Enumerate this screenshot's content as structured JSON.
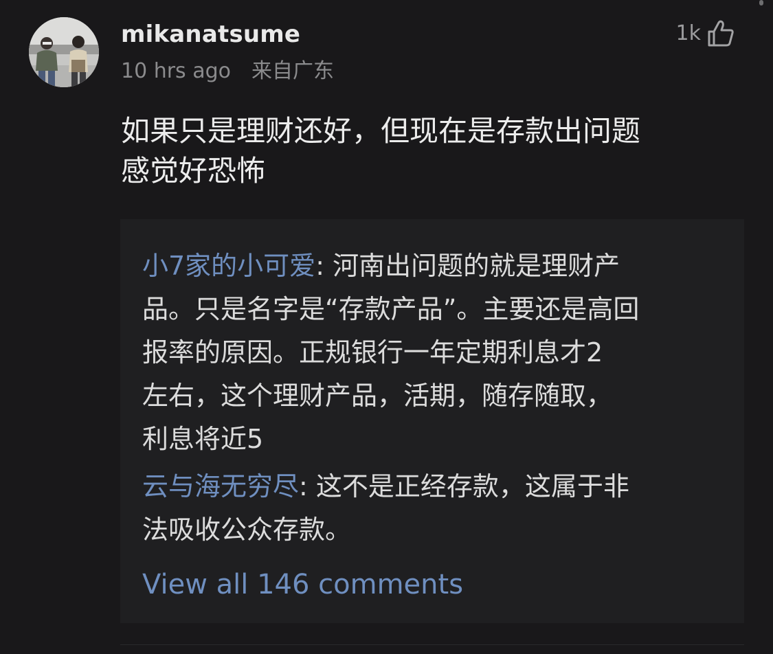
{
  "comment": {
    "username": "mikanatsume",
    "time": "10 hrs ago",
    "location": "来自广东",
    "likes": "1k",
    "text_lines": [
      "如果只是理财还好，但现在是存款出问题",
      "感觉好恐怖"
    ]
  },
  "replies": [
    {
      "author": "小7家的小可爱",
      "first_line": ": 河南出问题的就是理财产",
      "lines": [
        "品。只是名字是“存款产品”。主要还是高回",
        "报率的原因。正规银行一年定期利息才2",
        "左右，这个理财产品，活期，随存随取，",
        "利息将近5"
      ]
    },
    {
      "author": "云与海无穷尽",
      "first_line": ": 这不是正经存款，这属于非",
      "lines": [
        "法吸收公众存款。"
      ]
    }
  ],
  "view_all_label": "View all 146 comments",
  "colors": {
    "background": "#19181a",
    "reply_box": "#1f1f21",
    "link_blue": "#6f8fc0",
    "muted_text": "#8b8b8d"
  },
  "icons": {
    "like": "thumbs-up-outline-icon"
  }
}
